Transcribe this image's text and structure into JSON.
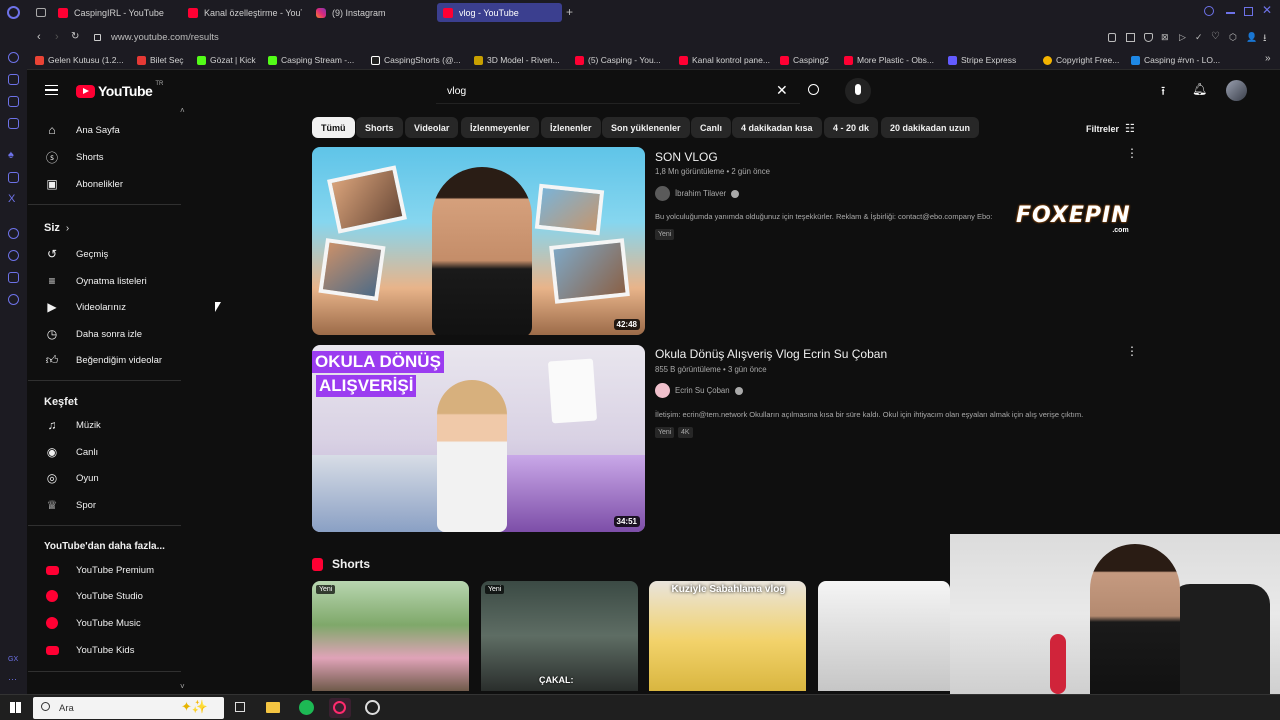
{
  "browser": {
    "tabs": [
      {
        "label": "CaspingIRL - YouTube",
        "active": false
      },
      {
        "label": "Kanal özelleştirme - YouTube",
        "active": false
      },
      {
        "label": "(9) Instagram",
        "active": false
      },
      {
        "label": "vlog - YouTube",
        "active": true
      }
    ],
    "url": "www.youtube.com/results",
    "bookmarks": [
      "Gelen Kutusu (1.2...",
      "Bilet Seç",
      "Gözat | Kick",
      "Casping Stream -...",
      "CaspingShorts (@...",
      "3D Model - Riven...",
      "(5) Casping - You...",
      "Kanal kontrol pane...",
      "Casping2",
      "More Plastic - Obs...",
      "Stripe Express",
      "Copyright Free...",
      "Casping #rvn - LO..."
    ]
  },
  "youtube": {
    "logo_text": "YouTube",
    "region": "TR",
    "search_query": "vlog",
    "nav_main": [
      "Ana Sayfa",
      "Shorts",
      "Abonelikler"
    ],
    "section_you": "Siz",
    "nav_you": [
      "Geçmiş",
      "Oynatma listeleri",
      "Videolarınız",
      "Daha sonra izle",
      "Beğendiğim videolar"
    ],
    "section_explore": "Keşfet",
    "nav_explore": [
      "Müzik",
      "Canlı",
      "Oyun",
      "Spor"
    ],
    "section_more": "YouTube'dan daha fazla...",
    "nav_more": [
      "YouTube Premium",
      "YouTube Studio",
      "YouTube Music",
      "YouTube Kids"
    ],
    "chips": [
      "Tümü",
      "Shorts",
      "Videolar",
      "İzlenmeyenler",
      "İzlenenler",
      "Son yüklenenler",
      "Canlı",
      "4 dakikadan kısa",
      "4 - 20 dk",
      "20 dakikadan uzun"
    ],
    "filters_label": "Filtreler",
    "results": [
      {
        "title": "SON VLOG",
        "meta": "1,8 Mn görüntüleme • 2 gün önce",
        "channel": "İbrahim Tilaver",
        "description": "Bu yolculuğumda yanımda olduğunuz için teşekkürler. Reklam & İşbirliği: contact@ebo.company Ebo:",
        "badges": [
          "Yeni"
        ],
        "duration": "42:48"
      },
      {
        "title": "Okula Dönüş Alışveriş Vlog Ecrin Su Çoban",
        "meta": "855 B görüntüleme • 3 gün önce",
        "channel": "Ecrin Su Çoban",
        "description": "İletişim: ecrin@tem.network Okulların açılmasına kısa bir süre kaldı. Okul için ihtiyacım olan eşyaları almak için alış verişe çıktım.",
        "badges": [
          "Yeni",
          "4K"
        ],
        "duration": "34:51",
        "thumb_text": [
          "OKULA DÖNÜŞ",
          "ALIŞVERİŞİ"
        ]
      }
    ],
    "shorts_heading": "Shorts",
    "shorts": [
      {
        "badge": "Yeni",
        "caption": ""
      },
      {
        "badge": "Yeni",
        "caption": "ÇAKAL:"
      },
      {
        "badge": "",
        "caption": "Kuziyle Sabahlama vlog"
      },
      {
        "badge": "",
        "caption": ""
      }
    ]
  },
  "overlay_logo": {
    "text": "FOXEPIN",
    "subtext": ".com"
  },
  "taskbar": {
    "search_placeholder": "Ara"
  },
  "colors": {
    "yt_red": "#ff0033",
    "bg": "#0f0f0f",
    "chip": "#272727",
    "opera_accent": "#6d72e8"
  }
}
